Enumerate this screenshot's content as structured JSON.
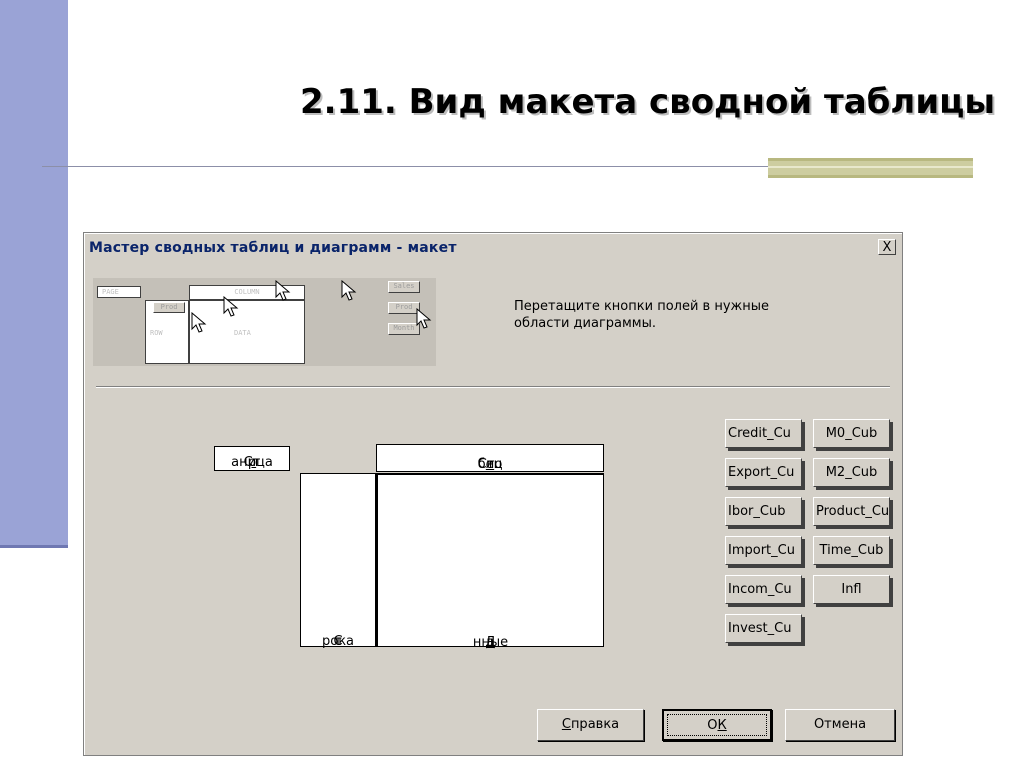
{
  "slide": {
    "title": "2.11.  Вид макета сводной таблицы"
  },
  "dialog": {
    "title": "Мастер сводных таблиц и диаграмм - макет",
    "close_label": "X",
    "instructions_line1": "Перетащите кнопки полей в нужные",
    "instructions_line2": "области диаграммы.",
    "preview": {
      "page_label": "PAGE",
      "column_label": "COLUMN",
      "row_label": "ROW",
      "data_label": "DATA",
      "prod_label": "Prod",
      "field1": "Sales",
      "field2": "Prod",
      "field3": "Month"
    },
    "areas": {
      "page": {
        "pre": "Ст",
        "u": "р",
        "post": "аница"
      },
      "column": {
        "pre": "Сто",
        "u": "л",
        "post": "бец"
      },
      "row": {
        "pre": "С",
        "u": "т",
        "post": "рока"
      },
      "data": {
        "pre": "Д",
        "u": "а",
        "post": "нные"
      }
    },
    "fields_left": [
      "Credit_Cu",
      "Export_Cu",
      "Ibor_Cub",
      "Import_Cu",
      "Incom_Cu",
      "Invest_Cu"
    ],
    "fields_right": [
      "M0_Cub",
      "M2_Cub",
      "Product_Cu",
      "Time_Cub",
      "Infl"
    ],
    "buttons": {
      "help": {
        "u": "С",
        "post": "правка"
      },
      "ok": {
        "pre": "О",
        "u": "К"
      },
      "cancel": "Отмена"
    }
  }
}
